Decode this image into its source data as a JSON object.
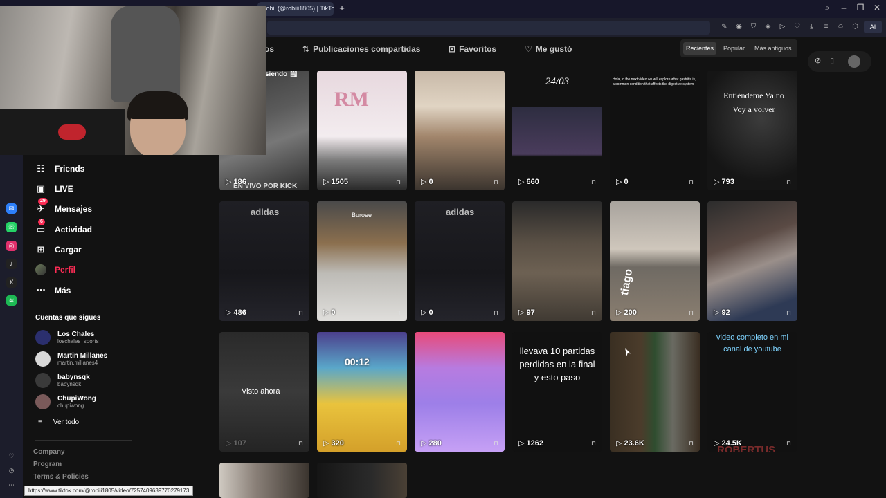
{
  "browser": {
    "tab_title": "Robii (@robiii1805) | TikTo",
    "new_tab": "+",
    "window_controls": [
      "⌕",
      "–",
      "❐",
      "✕"
    ],
    "toolbar_ai_label": "AI"
  },
  "rail": [
    {
      "icon": "messenger-icon",
      "color": "#2d7ff9",
      "glyph": "✉"
    },
    {
      "icon": "whatsapp-icon",
      "color": "#25d366",
      "glyph": "☏"
    },
    {
      "icon": "instagram-icon",
      "color": "#e1306c",
      "glyph": "◎"
    },
    {
      "icon": "tiktok-icon",
      "color": "#222222",
      "glyph": "♪"
    },
    {
      "icon": "x-icon",
      "color": "#222222",
      "glyph": "X"
    },
    {
      "icon": "spotify-icon",
      "color": "#1db954",
      "glyph": "≋"
    }
  ],
  "sidebar": {
    "nav": [
      {
        "label": "Friends",
        "icon": "friends-icon",
        "glyph": "👥"
      },
      {
        "label": "LIVE",
        "icon": "live-icon",
        "glyph": "▣"
      },
      {
        "label": "Mensajes",
        "icon": "messages-icon",
        "glyph": "✈",
        "badge": "29"
      },
      {
        "label": "Actividad",
        "icon": "activity-icon",
        "glyph": "▭",
        "badge": "6"
      },
      {
        "label": "Cargar",
        "icon": "upload-icon",
        "glyph": "⊞"
      },
      {
        "label": "Perfil",
        "icon": "profile-avatar",
        "glyph": ""
      },
      {
        "label": "Más",
        "icon": "more-icon",
        "glyph": "⋯"
      }
    ],
    "following_title": "Cuentas que sigues",
    "following": [
      {
        "name": "Los Chales",
        "handle": "loschales_sports"
      },
      {
        "name": "Martin Millanes",
        "handle": "martin.millanes4"
      },
      {
        "name": "babynsqk",
        "handle": "babynsqk"
      },
      {
        "name": "ChupiWong",
        "handle": "chupiwong"
      }
    ],
    "see_all": "Ver todo",
    "footer": [
      "Company",
      "Program",
      "Terms & Policies"
    ]
  },
  "profile_tabs": [
    {
      "label": "os",
      "icon": ""
    },
    {
      "label": "Publicaciones compartidas",
      "icon": "⇅"
    },
    {
      "label": "Favoritos",
      "icon": "⊡"
    },
    {
      "label": "Me gustó",
      "icon": "♡"
    }
  ],
  "sort": [
    "Recientes",
    "Popular",
    "Más antiguos"
  ],
  "videos": [
    {
      "stat": "186",
      "lock": false,
      "overlay_text": "EN VIVO POR KICK",
      "top_text": "siendo 🗒",
      "bg": "linear-gradient(160deg,#3a3a3a,#5b5b5b 40%,#777 60%,#2b2b2b)"
    },
    {
      "stat": "1505",
      "lock": true,
      "overlay_text": "RM",
      "bg": "linear-gradient(180deg,#e7d8de 0%,#f3ecef 55%,#7b7b7b 75%,#2a2a2a 100%)"
    },
    {
      "stat": "0",
      "lock": true,
      "overlay_text": "",
      "bg": "linear-gradient(180deg,#c8b9a8 0%,#e0d4c3 30%,#a2866c 55%,#3b342e 100%)"
    },
    {
      "stat": "660",
      "lock": true,
      "overlay_text": "24/03",
      "bg": "linear-gradient(180deg,#121212 0%,#121212 30%,#2d2d40 30%,#4a3c5c 70%,#121212 72%)"
    },
    {
      "stat": "0",
      "lock": true,
      "overlay_text": "Hola, in the next video we will explore what gastritis is, a common condition that affects the digestive system",
      "bg": "#111111"
    },
    {
      "stat": "793",
      "lock": true,
      "overlay_text": "Entiéndeme Ya no Voy a volver",
      "bg": "radial-gradient(circle at 60% 40%,#3c3c3c,#151515 70%)"
    },
    {
      "stat": "486",
      "lock": true,
      "overlay_text": "adidas",
      "bg": "linear-gradient(180deg,#1f1f24,#17171b 60%,#24242b)"
    },
    {
      "stat": "0",
      "lock": true,
      "overlay_text": "Buroee",
      "bg": "linear-gradient(180deg,#4a4a4a 0%,#8b6f4e 35%,#bdbbb6 60%,#dfdedb 100%)"
    },
    {
      "stat": "0",
      "lock": true,
      "overlay_text": "adidas",
      "bg": "linear-gradient(180deg,#1f1f24,#17171b 60%,#24242b)"
    },
    {
      "stat": "97",
      "lock": true,
      "overlay_text": "",
      "bg": "linear-gradient(180deg,#2a2a2a 0%,#5a5045 35%,#6d6153 60%,#403a33 100%)"
    },
    {
      "stat": "200",
      "lock": true,
      "overlay_text": "tiago",
      "bg": "linear-gradient(180deg,#a8a39d 0%,#cfc7bc 40%,#6f6a63 55%,#8a7e70 100%)"
    },
    {
      "stat": "92",
      "lock": true,
      "overlay_text": "",
      "bg": "linear-gradient(160deg,#2c2c2c 0%,#5a4a44 35%,#9a8f8a 55%,#2e3a55 85%)"
    },
    {
      "stat": "107",
      "lock": true,
      "overlay_text": "Visto ahora",
      "bg": "linear-gradient(180deg,#2a2a2a,#3a3a3a 50%,#242424)"
    },
    {
      "stat": "320",
      "lock": true,
      "overlay_text": "00:12",
      "bg": "linear-gradient(180deg,#4b3f8c 0%,#5aa7c9 30%,#e9c33d 60%,#d4a02a 100%)"
    },
    {
      "stat": "280",
      "lock": true,
      "overlay_text": "",
      "bg": "linear-gradient(180deg,#e84a7a 0%,#b77be0 30%,#9d7fe8 60%,#c6a0f5 100%)"
    },
    {
      "stat": "1262",
      "lock": true,
      "overlay_text": "llevava 10 partidas perdidas en la final y esto paso",
      "bg": "#111111"
    },
    {
      "stat": "23.6K",
      "lock": true,
      "overlay_text": "",
      "bg": "linear-gradient(90deg,#3a2f22 0%,#4b3c2b 35%,#2f4d2f 50%,#6a6a62 70%,#3a2e22 100%)"
    },
    {
      "stat": "24.5K",
      "lock": true,
      "overlay_text": "video completo en mi canal de youtube",
      "bottom_text": "ROBERTUS",
      "bg": "#111111"
    },
    {
      "stat": "",
      "lock": false,
      "overlay_text": "",
      "bg": "linear-gradient(90deg,#cfc9c1,#8a8078 40%,#3a342e)"
    },
    {
      "stat": "",
      "lock": false,
      "overlay_text": "",
      "bg": "linear-gradient(90deg,#151515,#2a2a2a 60%,#4a4035)"
    }
  ],
  "status_url": "https://www.tiktok.com/@robiii1805/video/7257409639770279173"
}
